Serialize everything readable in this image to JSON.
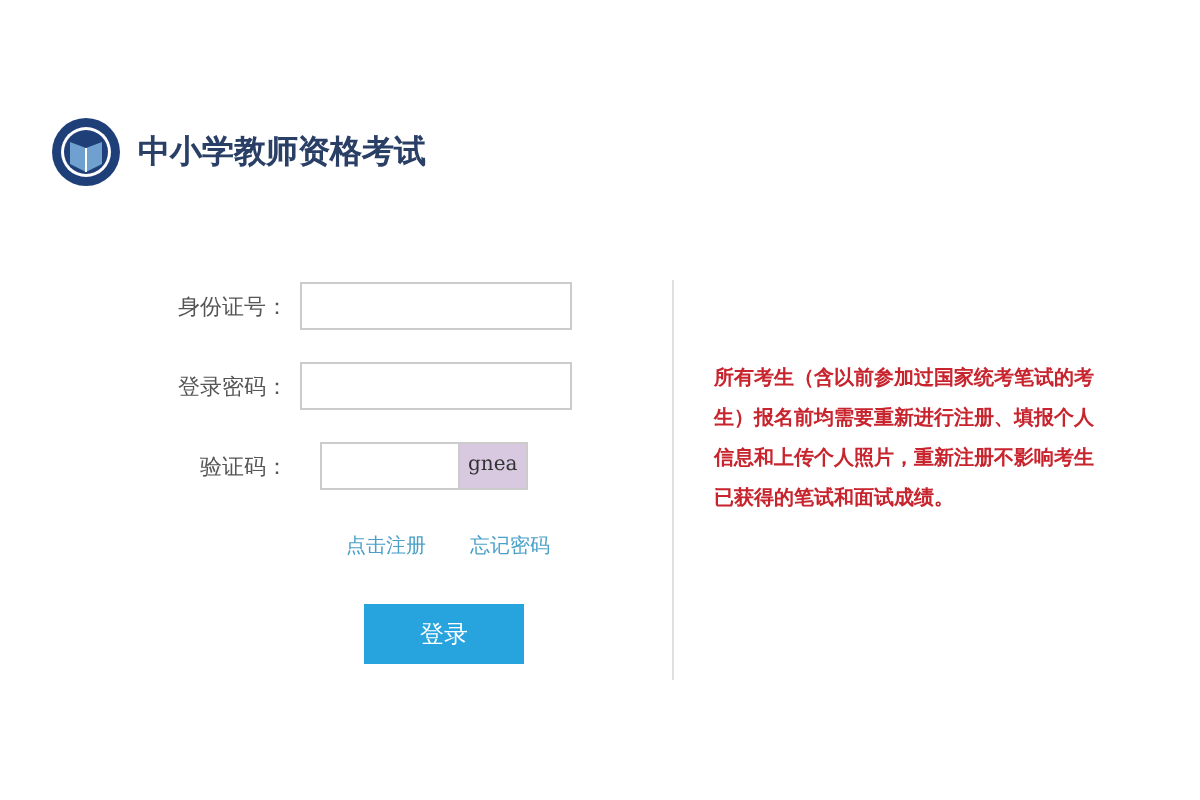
{
  "header": {
    "title": "中小学教师资格考试"
  },
  "form": {
    "fields": [
      {
        "kind": "text",
        "label": "身份证号："
      },
      {
        "kind": "text",
        "label": "登录密码："
      },
      {
        "kind": "captcha",
        "label": "验证码：",
        "captcha": "gnea"
      }
    ],
    "links": [
      "点击注册",
      "忘记密码"
    ],
    "submit": "登录"
  },
  "notice": "所有考生（含以前参加过国家统考笔试的考生）报名前均需要重新进行注册、填报个人信息和上传个人照片，重新注册不影响考生已获得的笔试和面试成绩。"
}
